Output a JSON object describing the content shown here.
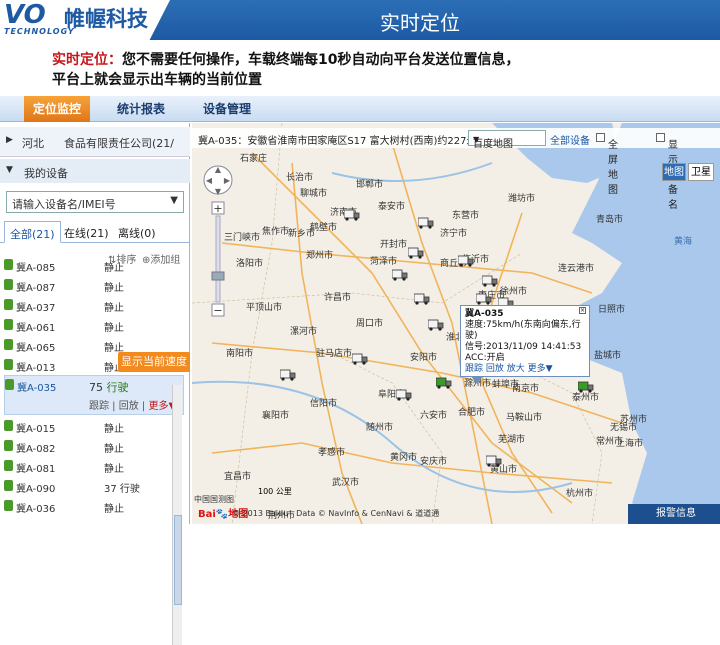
{
  "banner": {
    "logo_vo": "VO",
    "logo_cn": "帷幄科技",
    "logo_en": "TECHNOLOGY",
    "title": "实时定位"
  },
  "description": {
    "label": "实时定位：",
    "line1": "您不需要任何操作，车载终端每10秒自动向平台发送位置信息，",
    "line2": "平台上就会显示出车辆的当前位置"
  },
  "nav": {
    "tabs": [
      "定位监控",
      "统计报表",
      "设备管理"
    ],
    "active": 0
  },
  "sidebar": {
    "company_prefix": "河北",
    "company": "食品有限责任公司(21/",
    "my_devices": "我的设备",
    "search_placeholder": "请输入设备名/IMEI号",
    "tabs": [
      "全部(21)",
      "在线(21)",
      "离线(0)"
    ],
    "sort": "排序",
    "add_group": "添加组",
    "devices": [
      {
        "name": "冀A-085",
        "status": "静止"
      },
      {
        "name": "冀A-087",
        "status": "静止"
      },
      {
        "name": "冀A-037",
        "status": "静止"
      },
      {
        "name": "冀A-061",
        "status": "静止"
      },
      {
        "name": "冀A-065",
        "status": "静止"
      },
      {
        "name": "冀A-013",
        "status": "静止"
      }
    ],
    "selected": {
      "name": "冀A-035",
      "speed": "75",
      "status": "行驶",
      "track": "跟踪",
      "playback": "回放",
      "more": "更多▼"
    },
    "devices2": [
      {
        "name": "冀A-015",
        "status": "静止"
      },
      {
        "name": "冀A-082",
        "status": "静止"
      },
      {
        "name": "冀A-081",
        "status": "静止"
      },
      {
        "name": "冀A-090",
        "status": "37 行驶"
      },
      {
        "name": "冀A-036",
        "status": "静止"
      }
    ],
    "callout": "显示当前速度"
  },
  "map": {
    "location_text": "冀A-035：安徽省淮南市田家庵区S17 富大树村(西南)约227米",
    "map_provider": "百度地图",
    "all_devices": "全部设备",
    "fullscreen": "全屏地图",
    "show_names": "显示设备名",
    "type_map": "地图",
    "type_satellite": "卫星",
    "popup": {
      "title": "冀A-035",
      "speed": "速度:75km/h(东南向偏东,行驶)",
      "signal": "信号:2013/11/09 14:41:53",
      "acc": "ACC:开启",
      "links": "跟踪 回放 放大 更多▼"
    },
    "labels": [
      "石家庄",
      "长治市",
      "新乡市",
      "郑州市",
      "开封市",
      "商丘市",
      "徐州市",
      "济南市",
      "泰安市",
      "临沂市",
      "连云港市",
      "漯河市",
      "驻马店市",
      "信阳市",
      "合肥市",
      "淮安市",
      "南京市",
      "扬州市",
      "上海市",
      "杭州市",
      "武汉市",
      "宜昌市",
      "周口市",
      "阜阳市",
      "淮北市",
      "宿州市",
      "黄海",
      "平顶山市",
      "南阳市",
      "洛阳市",
      "日照市",
      "盐城市",
      "泰州市",
      "苏州市",
      "芜湖市",
      "荆州市",
      "孝感市",
      "黄冈市",
      "东营市",
      "青岛市",
      "潍坊市",
      "菏泽市",
      "济宁市",
      "聊城市",
      "安庆市",
      "黄山市",
      "宿迁市",
      "常州市",
      "无锡市",
      "马鞍山市",
      "襄阳市",
      "随州市",
      "枣庄市",
      "邯郸市",
      "许昌市",
      "三门峡市",
      "焦作市",
      "鹤壁市",
      "安阳市",
      "蚌埠市",
      "滁州市",
      "六安市"
    ],
    "baidu": "Bai🐾地图",
    "copyright": "© 2013 Baidu - Data © NavInfo & CenNavi & 道道通",
    "gov": "中国国测图",
    "scale": "100 公里",
    "alarm": "报警信息"
  }
}
